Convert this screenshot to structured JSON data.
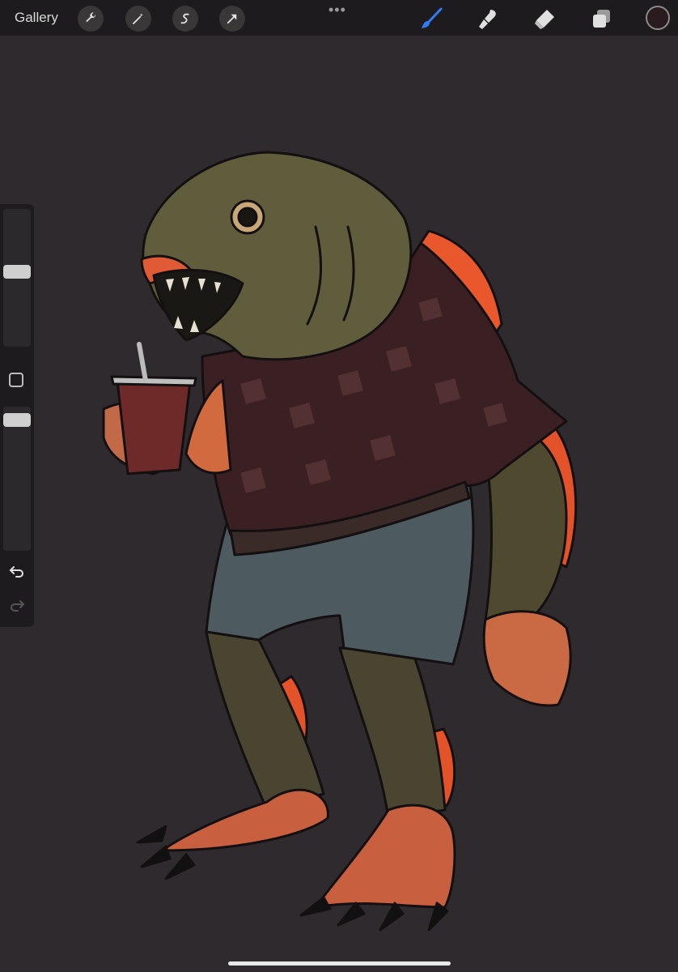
{
  "topbar": {
    "gallery_label": "Gallery",
    "more_label": "•••",
    "left_tools": [
      "wrench-icon",
      "magic-wand-icon",
      "selection-s-icon",
      "transform-arrow-icon"
    ],
    "right_tools": [
      "brush-icon",
      "smudge-icon",
      "eraser-icon",
      "layers-icon"
    ],
    "active_tool": "brush-icon",
    "active_color": "#2a1c1e",
    "accent": "#2f7cf6"
  },
  "sidebar": {
    "brush_size_level": 0.55,
    "opacity_level": 0.05,
    "tools": [
      "modify-square-icon",
      "undo-icon",
      "redo-icon"
    ]
  },
  "canvas": {
    "artwork": "fish-creature-illustration",
    "background": "#2f2a2d"
  }
}
